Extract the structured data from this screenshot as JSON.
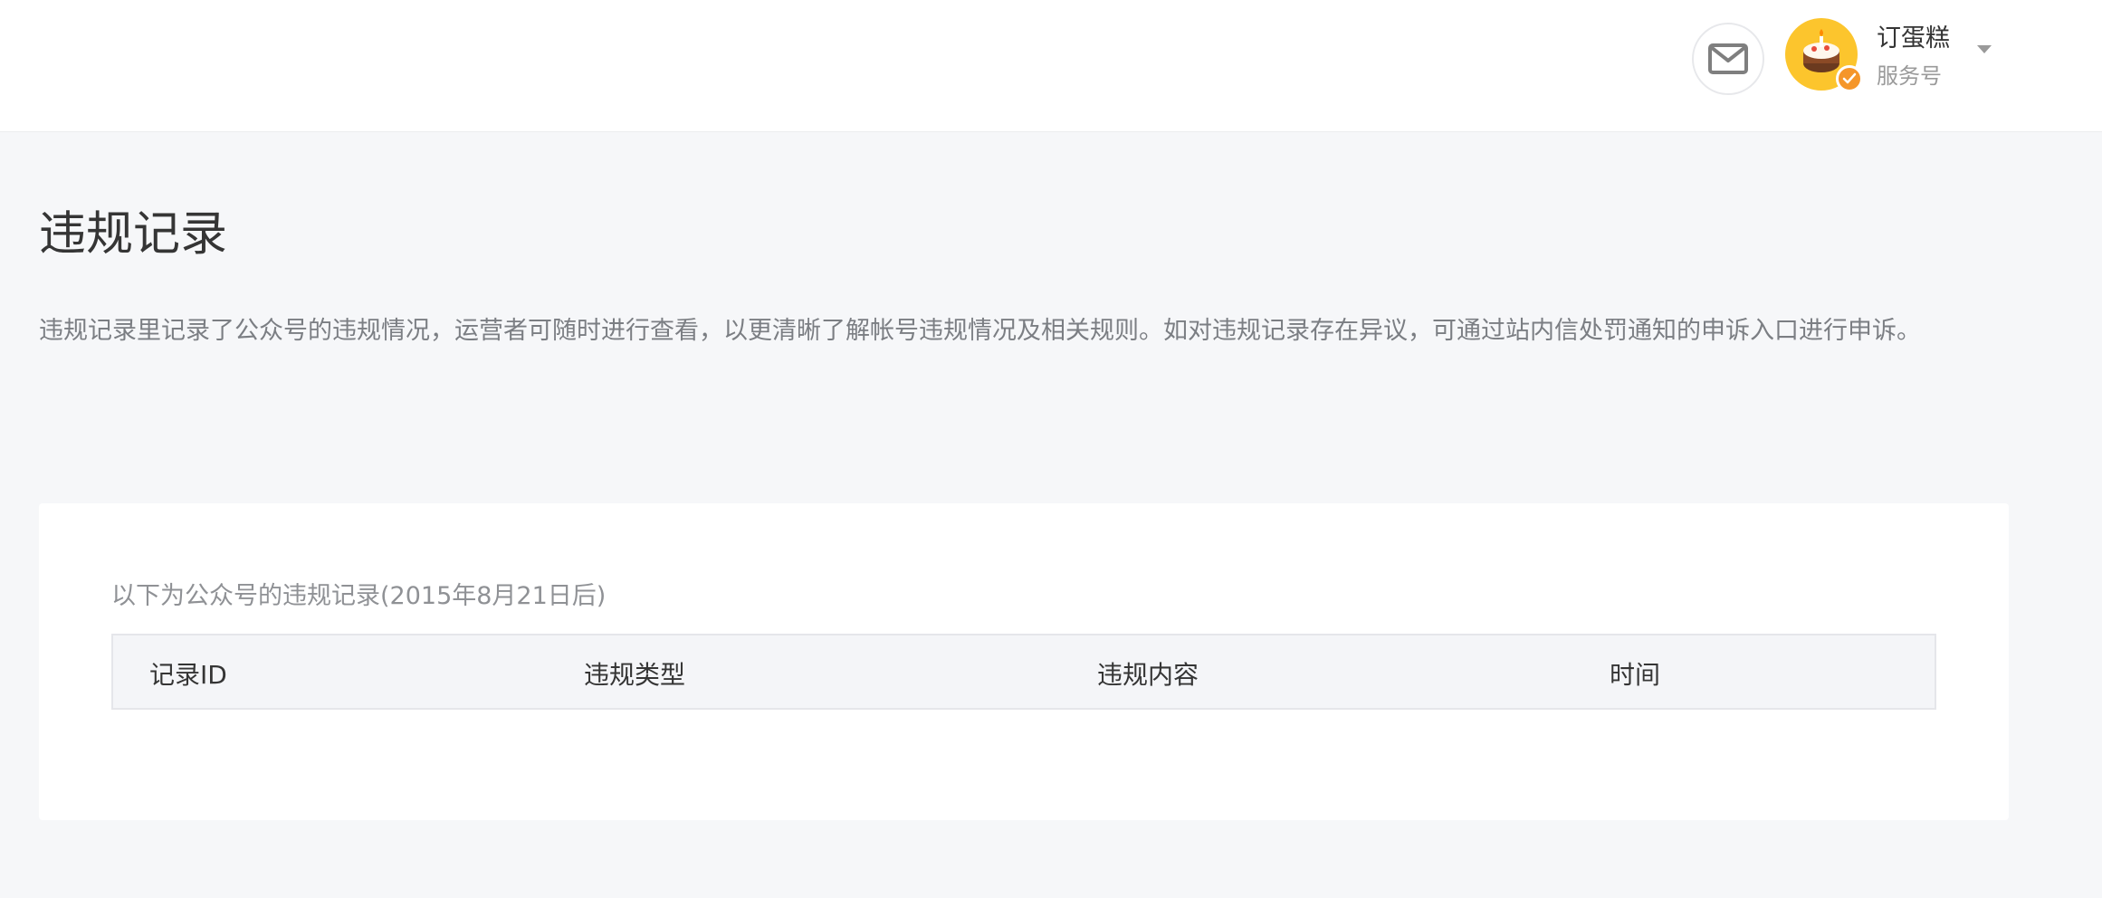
{
  "header": {
    "mail_icon": "mail-icon",
    "account": {
      "name": "订蛋糕",
      "type": "服务号",
      "avatar_icon": "cake-avatar",
      "verified_icon": "verified-check-icon",
      "dropdown_icon": "caret-down-icon"
    }
  },
  "page": {
    "title": "违规记录",
    "description": "违规记录里记录了公众号的违规情况，运营者可随时进行查看，以更清晰了解帐号违规情况及相关规则。如对违规记录存在异议，可通过站内信处罚通知的申诉入口进行申诉。"
  },
  "records": {
    "subtitle": "以下为公众号的违规记录(2015年8月21日后)",
    "columns": [
      "记录ID",
      "违规类型",
      "违规内容",
      "时间"
    ],
    "rows": []
  },
  "colors": {
    "background": "#f6f7f9",
    "accent_verified": "#f5962a",
    "avatar_bg": "#fcc52d"
  }
}
